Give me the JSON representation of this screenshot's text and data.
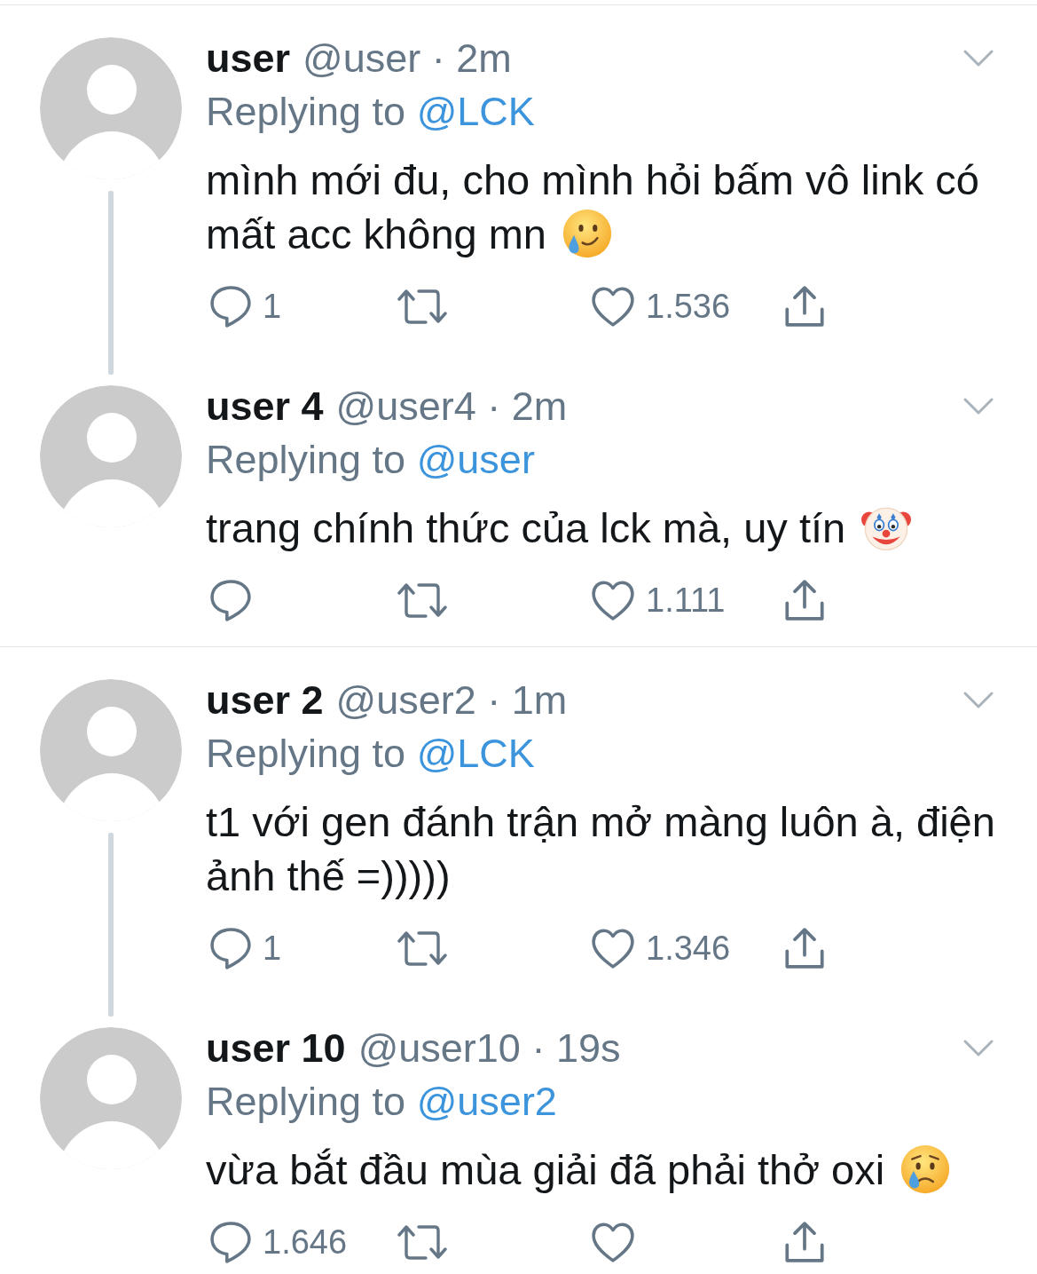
{
  "threads": [
    {
      "tweets": [
        {
          "author": "user",
          "handle": "@user",
          "separator": "·",
          "time": "2m",
          "replying_label": "Replying to",
          "replying_mention": "@LCK",
          "text": "mình mới đu, cho mình hỏi bấm vô link có mất acc không mn",
          "emoji": {
            "kind": "tear"
          },
          "replies": "1",
          "likes": "1.536"
        },
        {
          "author": "user 4",
          "handle": "@user4",
          "separator": "·",
          "time": "2m",
          "replying_label": "Replying to",
          "replying_mention": "@user",
          "text": "trang chính thức của lck mà, uy tín",
          "emoji": {
            "kind": "clown"
          },
          "likes": "1.111"
        }
      ]
    },
    {
      "tweets": [
        {
          "author": "user 2",
          "handle": "@user2",
          "separator": "·",
          "time": "1m",
          "replying_label": "Replying to",
          "replying_mention": "@LCK",
          "text": "t1 với gen đánh trận mở màng luôn à, điện ảnh thế =)))))",
          "replies": "1",
          "likes": "1.346"
        },
        {
          "author": "user 10",
          "handle": "@user10",
          "separator": "·",
          "time": "19s",
          "replying_label": "Replying to",
          "replying_mention": "@user2",
          "text": "vừa bắt đầu mùa giải đã phải thở oxi",
          "emoji": {
            "kind": "crying"
          },
          "replies": "1.646"
        }
      ]
    }
  ]
}
